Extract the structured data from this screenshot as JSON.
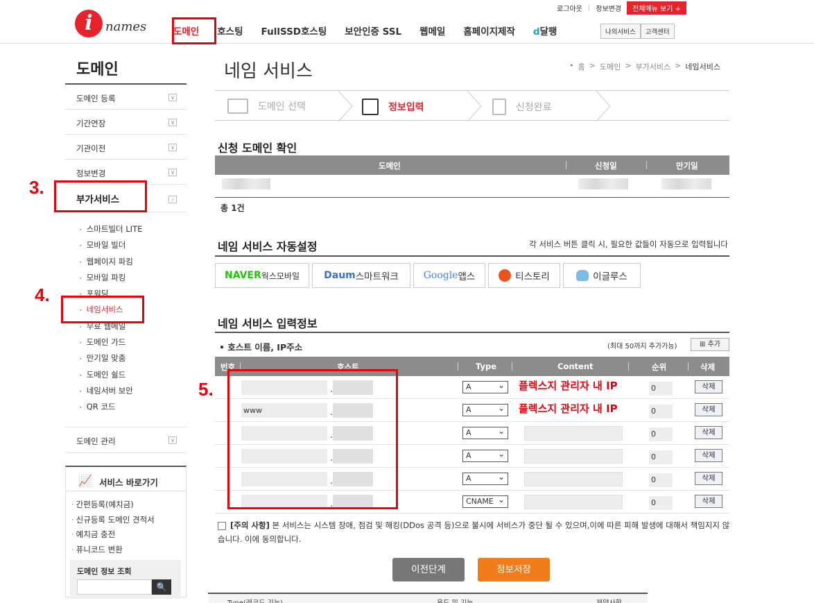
{
  "header": {
    "util": {
      "logout": "로그아웃",
      "info_change": "정보변경",
      "all_menu": "전체메뉴 보기 +"
    },
    "logo": {
      "mark": "i",
      "text": "names"
    },
    "gnb": [
      "도메인",
      "호스팅",
      "FullSSD호스팅",
      "보안인증 SSL",
      "웹메일",
      "홈페이지제작",
      "달팽"
    ],
    "gnb_dal_prefix": "d",
    "my_service": "나의서비스",
    "customer_center": "고객센터"
  },
  "annotations": {
    "step3": "3.",
    "step4": "4.",
    "step5": "5."
  },
  "sidebar": {
    "title": "도메인",
    "menus": [
      "도메인 등록",
      "기간연장",
      "기관이전",
      "정보변경",
      "부가서비스"
    ],
    "sub_items": [
      "스마트빌더 LITE",
      "모바일 빌더",
      "웹페이지 파킹",
      "모바일 파킹",
      "포워딩",
      "네임서비스",
      "무료 웹메일",
      "도메인 가드",
      "만기일 맞춤",
      "도메인 쉴드",
      "네임서버 보안",
      "QR 코드"
    ],
    "menu_domain_manage": "도메인 관리",
    "shortcut": {
      "title": "서비스 바로가기",
      "links": [
        "간편등록(예치금)",
        "신규등록 도메인 견적서",
        "예치금 충전",
        "퓨니코드 변환"
      ],
      "lookup_title": "도메인 정보 조회",
      "lookup_btn": "🔍"
    }
  },
  "main": {
    "title": "네임 서비스",
    "breadcrumb": [
      "홈",
      "도메인",
      "부가서비스",
      "네임서비스"
    ],
    "steps": [
      "도메인 선택",
      "정보입력",
      "신청완료"
    ],
    "confirm": {
      "title": "신청 도메인 확인",
      "headers": [
        "도메인",
        "신청일",
        "만기일"
      ],
      "total": "총 1건"
    },
    "auto": {
      "title": "네임 서비스 자동설정",
      "note": "각 서비스 버튼 클릭 시, 필요한 값들이 자동으로 입력됩니다",
      "naver": "NAVER",
      "naver_rest": " 웍스모바일",
      "daum": "Daum",
      "daum_rest": " 스마트워크",
      "google": "Google",
      "google_rest": " 앱스",
      "tistory": "티스토리",
      "egloos": "이글루스"
    },
    "input": {
      "title": "네임 서비스 입력정보",
      "subtitle": "• 호스트 이름, IP주소",
      "max_note": "(최대 50까지 추가가능)",
      "add_btn": "⊞ 추가",
      "headers": [
        "번호",
        "호스트",
        "Type",
        "Content",
        "순위",
        "삭제"
      ],
      "rows": [
        {
          "host": "",
          "type": "A",
          "content": "플렉스지 관리자 내 IP",
          "order": "0",
          "del": "삭제"
        },
        {
          "host": "www",
          "type": "A",
          "content": "플렉스지 관리자 내 IP",
          "order": "0",
          "del": "삭제"
        },
        {
          "host": "",
          "type": "A",
          "content": "",
          "order": "0",
          "del": "삭제"
        },
        {
          "host": "",
          "type": "A",
          "content": "",
          "order": "0",
          "del": "삭제"
        },
        {
          "host": "",
          "type": "A",
          "content": "",
          "order": "0",
          "del": "삭제"
        },
        {
          "host": "",
          "type": "CNAME",
          "content": "",
          "order": "0",
          "del": "삭제"
        }
      ]
    },
    "notice_bold": "[주의 사항]",
    "notice_rest": " 본 서비스는 시스템 장애, 점검 및 해킹(DDos 공격 등)으로 불시에 서비스가 중단 될 수 있으며,이에 따른 피해 발생에 대해서 책임지지 않습니다. 이에 동의합니다.",
    "prev_btn": "이전단계",
    "save_btn": "정보저장",
    "bottom_headers": [
      "Type(레코드 기능)",
      "용도 및 기능",
      "제약사항"
    ]
  },
  "colors": {
    "accent": "#e8222a",
    "annotation": "#e8000b",
    "save": "#f07d1a"
  }
}
